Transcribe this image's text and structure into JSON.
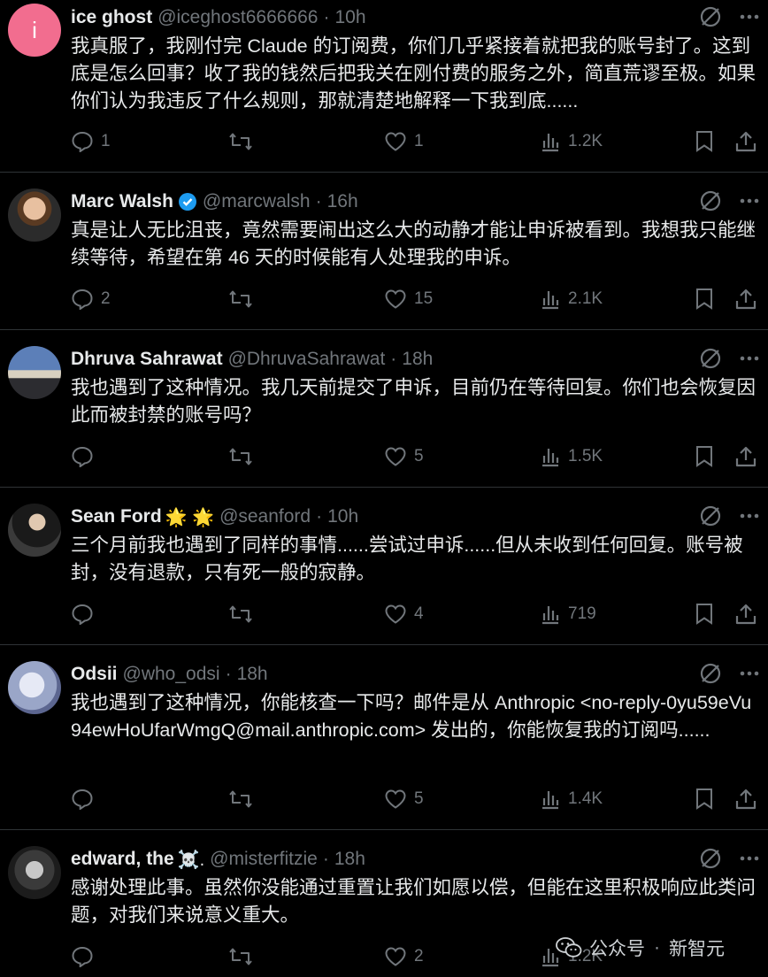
{
  "tweets": [
    {
      "name": "ice ghost",
      "handle": "@iceghost6666666",
      "time": "10h",
      "avatar_letter": "i",
      "text": "我真服了，我刚付完 Claude 的订阅费，你们几乎紧接着就把我的账号封了。这到底是怎么回事？收了我的钱然后把我关在刚付费的服务之外，简直荒谬至极。如果你们认为我违反了什么规则，那就清楚地解释一下我到底......",
      "replies": "1",
      "reposts": "",
      "likes": "1",
      "views": "1.2K"
    },
    {
      "name": "Marc Walsh",
      "handle": "@marcwalsh",
      "time": "16h",
      "verified": true,
      "text": "真是让人无比沮丧，竟然需要闹出这么大的动静才能让申诉被看到。我想我只能继续等待，希望在第 46 天的时候能有人处理我的申诉。",
      "replies": "2",
      "reposts": "",
      "likes": "15",
      "views": "2.1K"
    },
    {
      "name": "Dhruva Sahrawat",
      "handle": "@DhruvaSahrawat",
      "time": "18h",
      "text": "我也遇到了这种情况。我几天前提交了申诉，目前仍在等待回复。你们也会恢复因此而被封禁的账号吗？",
      "replies": "",
      "reposts": "",
      "likes": "5",
      "views": "1.5K"
    },
    {
      "name": "Sean Ford",
      "name_emoji": "🌟 🌟",
      "handle": "@seanford",
      "time": "10h",
      "text": "三个月前我也遇到了同样的事情......尝试过申诉......但从未收到任何回复。账号被封，没有退款，只有死一般的寂静。",
      "replies": "",
      "reposts": "",
      "likes": "4",
      "views": "719"
    },
    {
      "name": "Odsii",
      "handle": "@who_odsi",
      "time": "18h",
      "text": "我也遇到了这种情况，你能核查一下吗？邮件是从 Anthropic <no-reply-0yu59eVu94ewHoUfarWmgQ@mail.anthropic.com> 发出的，你能恢复我的订阅吗......",
      "replies": "",
      "reposts": "",
      "likes": "5",
      "views": "1.4K"
    },
    {
      "name": "edward, the",
      "name_emoji": "☠️.",
      "handle": "@misterfitzie",
      "time": "18h",
      "text": "感谢处理此事。虽然你没能通过重置让我们如愿以偿，但能在这里积极响应此类问题，对我们来说意义重大。",
      "replies": "",
      "reposts": "",
      "likes": "2",
      "views": "1.2K"
    }
  ],
  "watermark": {
    "account_label": "公众号",
    "separator": "·",
    "account_name": "新智元"
  },
  "colors": {
    "background": "#000000",
    "text": "#e7e9ea",
    "muted": "#71767b",
    "verified": "#1d9bf0",
    "divider": "#2f3336"
  }
}
